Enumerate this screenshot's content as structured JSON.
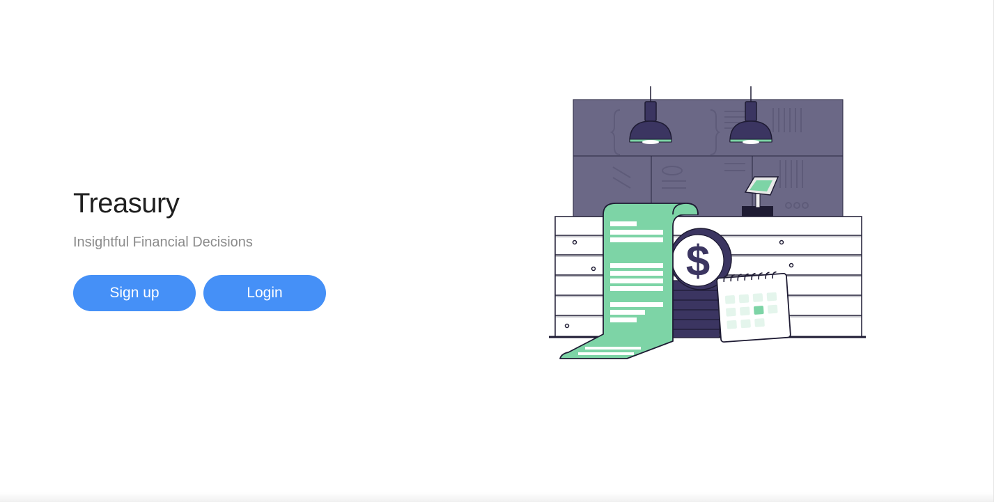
{
  "hero": {
    "title": "Treasury",
    "subtitle": "Insightful Financial Decisions"
  },
  "actions": {
    "signup_label": "Sign up",
    "login_label": "Login"
  },
  "illustration": {
    "currency_symbol": "$"
  },
  "colors": {
    "primary_button": "#4590f7",
    "title_text": "#1f1f1f",
    "subtitle_text": "#8b8b8b",
    "wall_purple": "#6b6886",
    "dark_purple": "#3b3561",
    "mint_green": "#7dd4a6"
  }
}
